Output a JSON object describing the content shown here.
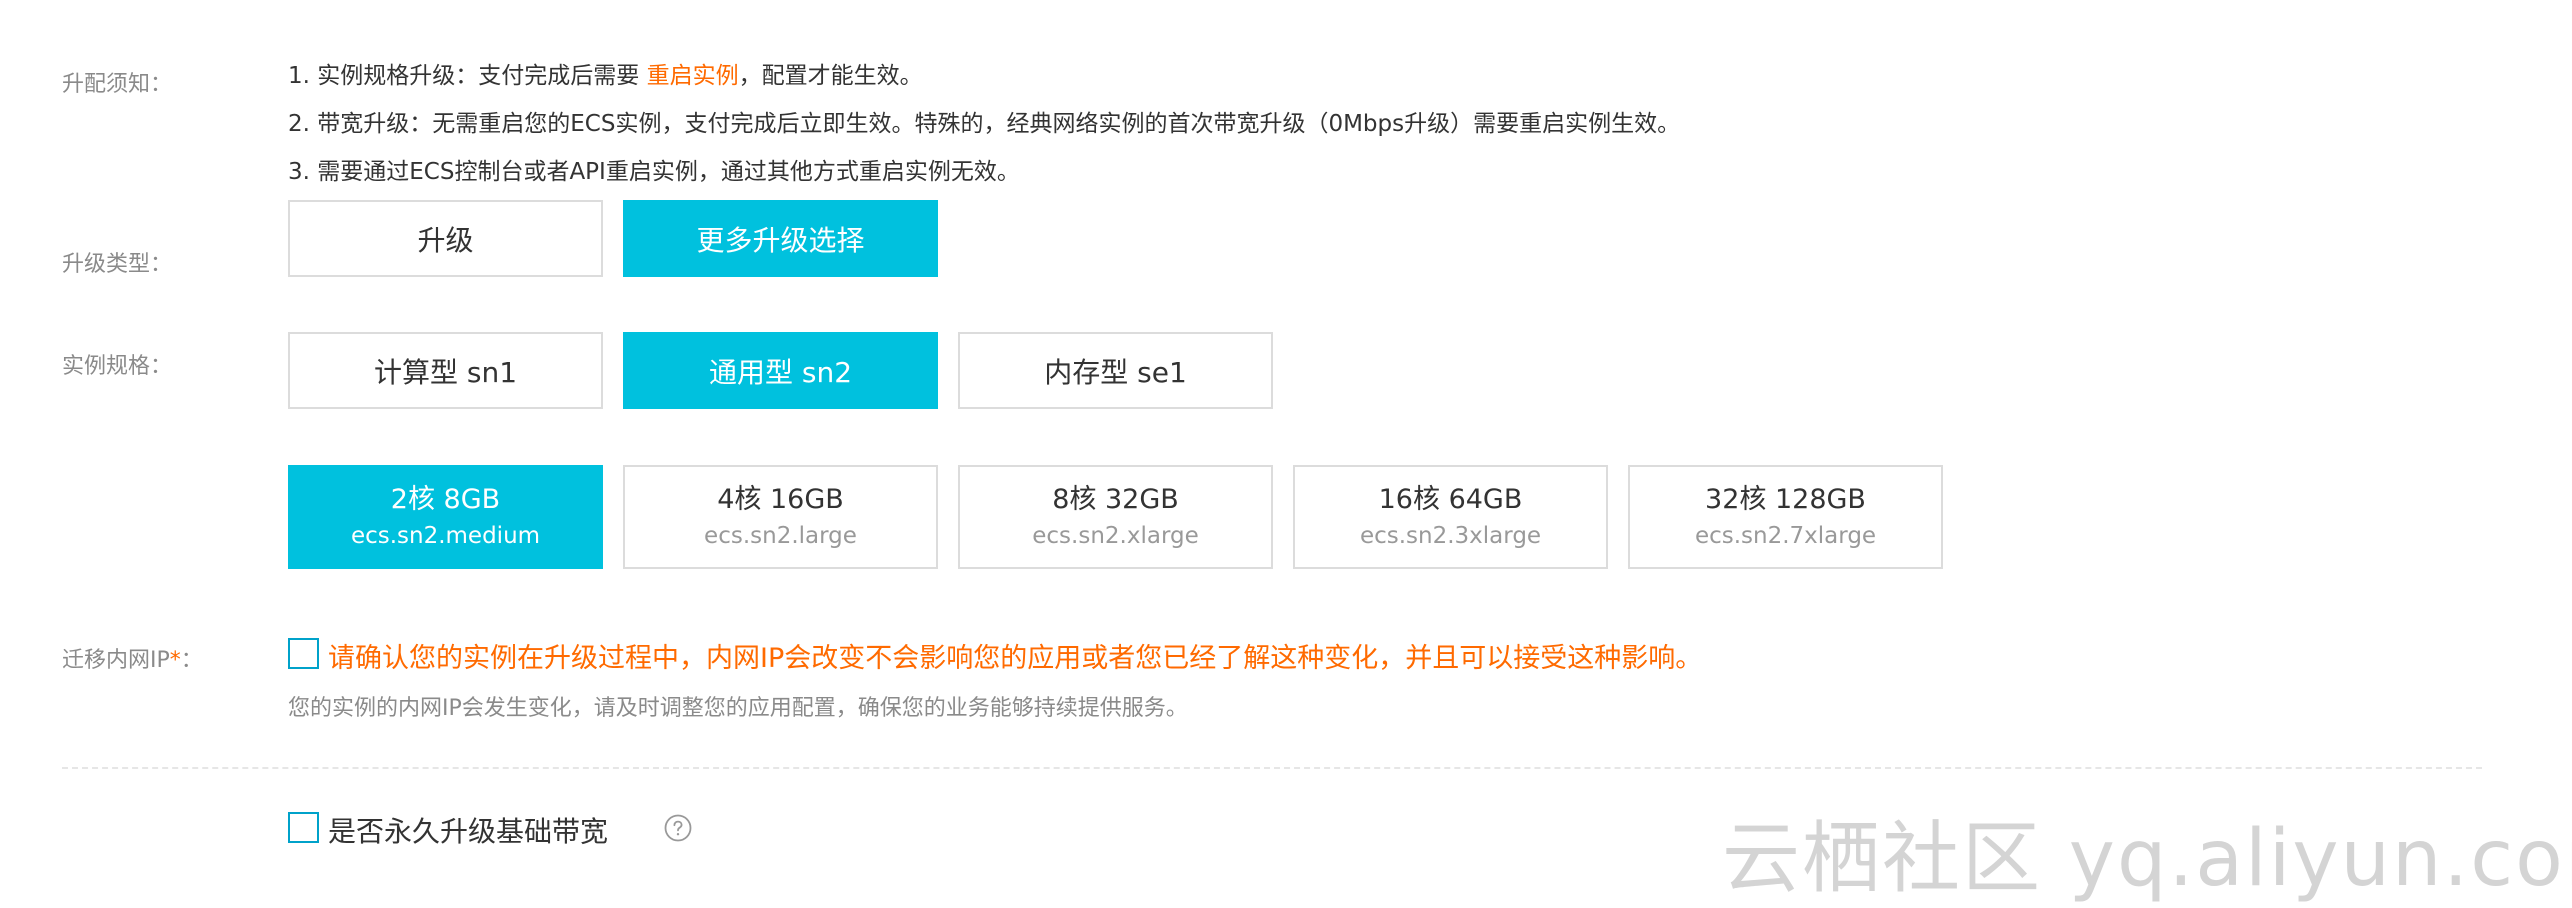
{
  "notice": {
    "label": "升配须知：",
    "line1_prefix": "1. 实例规格升级：支付完成后需要 ",
    "line1_highlight": "重启实例",
    "line1_suffix": "，配置才能生效。",
    "line2": "2. 带宽升级：无需重启您的ECS实例，支付完成后立即生效。特殊的，经典网络实例的首次带宽升级（0Mbps升级）需要重启实例生效。",
    "line3": "3. 需要通过ECS控制台或者API重启实例，通过其他方式重启实例无效。"
  },
  "upgrade_type": {
    "label": "升级类型：",
    "options": [
      "升级",
      "更多升级选择"
    ],
    "selected": "更多升级选择"
  },
  "instance_spec": {
    "label": "实例规格：",
    "families": [
      "计算型 sn1",
      "通用型 sn2",
      "内存型 se1"
    ],
    "selected_family": "通用型 sn2",
    "specs": [
      {
        "main": "2核 8GB",
        "sub": "ecs.sn2.medium"
      },
      {
        "main": "4核 16GB",
        "sub": "ecs.sn2.large"
      },
      {
        "main": "8核 32GB",
        "sub": "ecs.sn2.xlarge"
      },
      {
        "main": "16核 64GB",
        "sub": "ecs.sn2.3xlarge"
      },
      {
        "main": "32核 128GB",
        "sub": "ecs.sn2.7xlarge"
      }
    ],
    "selected_spec": "ecs.sn2.medium"
  },
  "migrate_ip": {
    "label": "迁移内网IP",
    "required_mark": "*",
    "colon": "：",
    "checked": false,
    "warning": "请确认您的实例在升级过程中，内网IP会改变不会影响您的应用或者您已经了解这种变化，并且可以接受这种影响。",
    "hint": "您的实例的内网IP会发生变化，请及时调整您的应用配置，确保您的业务能够持续提供服务。"
  },
  "bandwidth": {
    "label": "是否永久升级基础带宽",
    "checked": false,
    "help_icon": "question-circle-icon"
  },
  "watermark": "云栖社区 yq.aliyun.com",
  "colors": {
    "accent": "#00c1de",
    "warning": "#ff6a00",
    "label_gray": "#8a8a8a",
    "border": "#dcdcdc"
  }
}
